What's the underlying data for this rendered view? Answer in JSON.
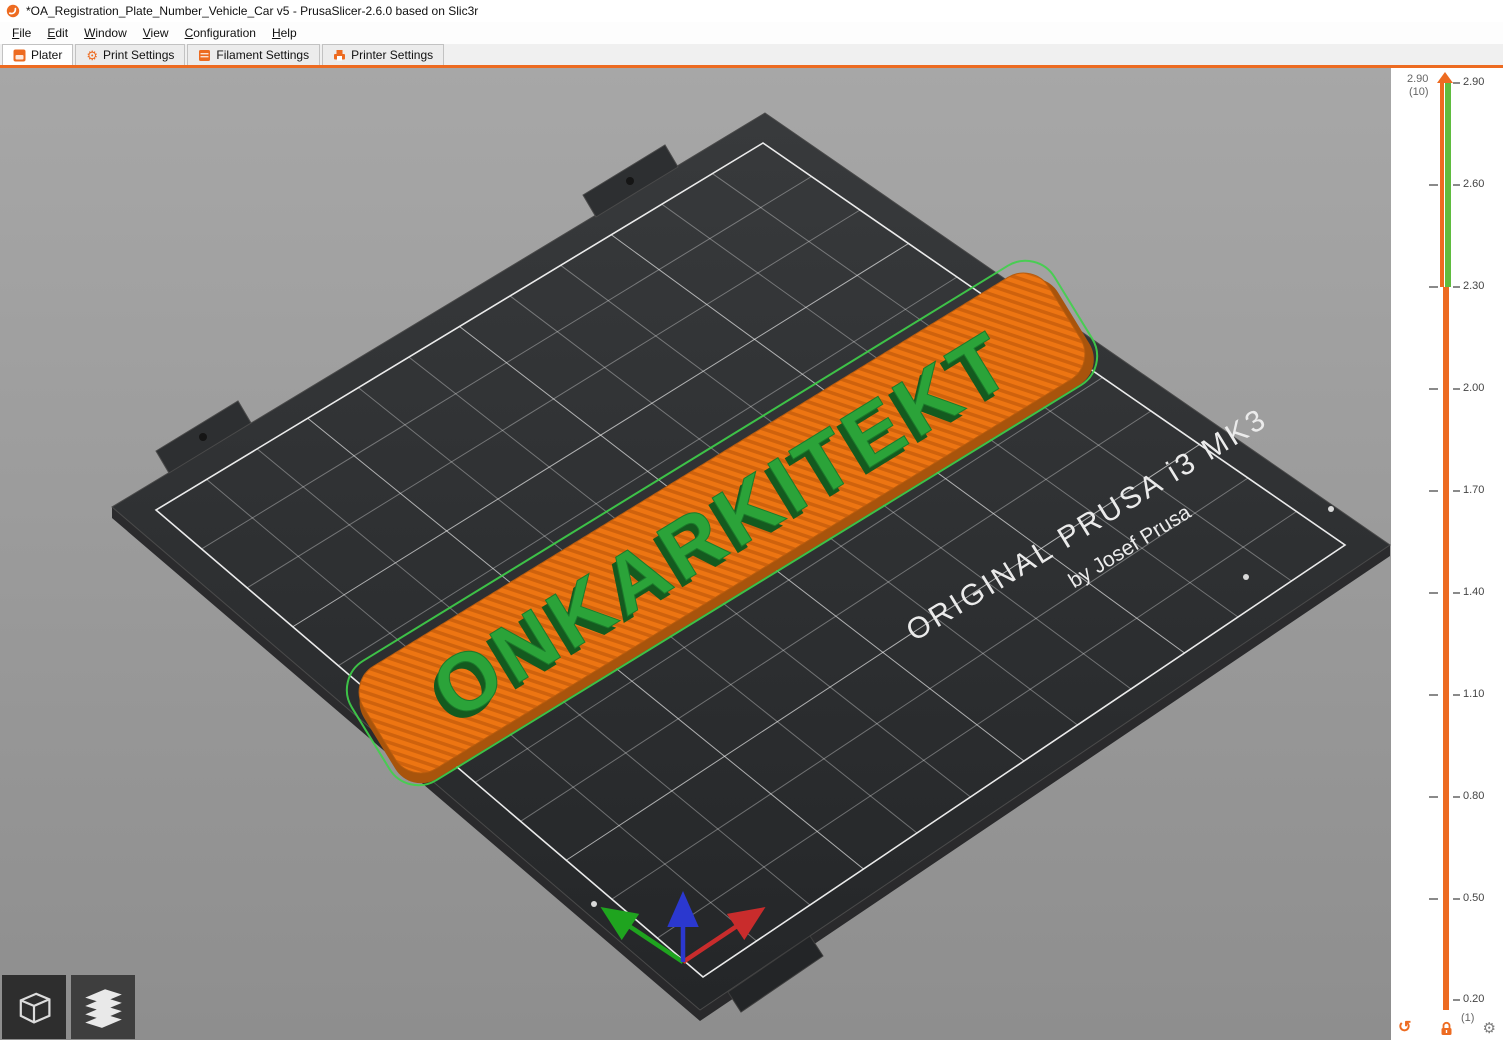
{
  "window": {
    "title": "*OA_Registration_Plate_Number_Vehicle_Car v5 - PrusaSlicer-2.6.0 based on Slic3r"
  },
  "menubar": {
    "items": [
      {
        "m": "F",
        "rest": "ile"
      },
      {
        "m": "E",
        "rest": "dit"
      },
      {
        "m": "W",
        "rest": "indow"
      },
      {
        "m": "V",
        "rest": "iew"
      },
      {
        "m": "C",
        "rest": "onfiguration"
      },
      {
        "m": "H",
        "rest": "elp"
      }
    ]
  },
  "tabs": {
    "plater": "Plater",
    "print_settings": "Print Settings",
    "filament_settings": "Filament Settings",
    "printer_settings": "Printer Settings"
  },
  "scene": {
    "object_text": "ONKARKITEKT",
    "bed_brand_line1": "ORIGINAL PRUSA i3 MK3",
    "bed_brand_line2": "by Josef Prusa"
  },
  "layer_slider": {
    "top_value": "2.90",
    "top_layer_index": "(10)",
    "bottom_layer_index": "(1)",
    "ticks": [
      "2.90",
      "2.60",
      "2.30",
      "2.00",
      "1.70",
      "1.40",
      "1.10",
      "0.80",
      "0.50",
      "0.20"
    ]
  },
  "icons": {
    "undo": "↺",
    "gear": "⚙"
  },
  "colors": {
    "accent": "#ED6B21",
    "object_orange": "#ED7512",
    "object_text_green": "#2BA339",
    "slider_green": "#5FBC3F"
  }
}
